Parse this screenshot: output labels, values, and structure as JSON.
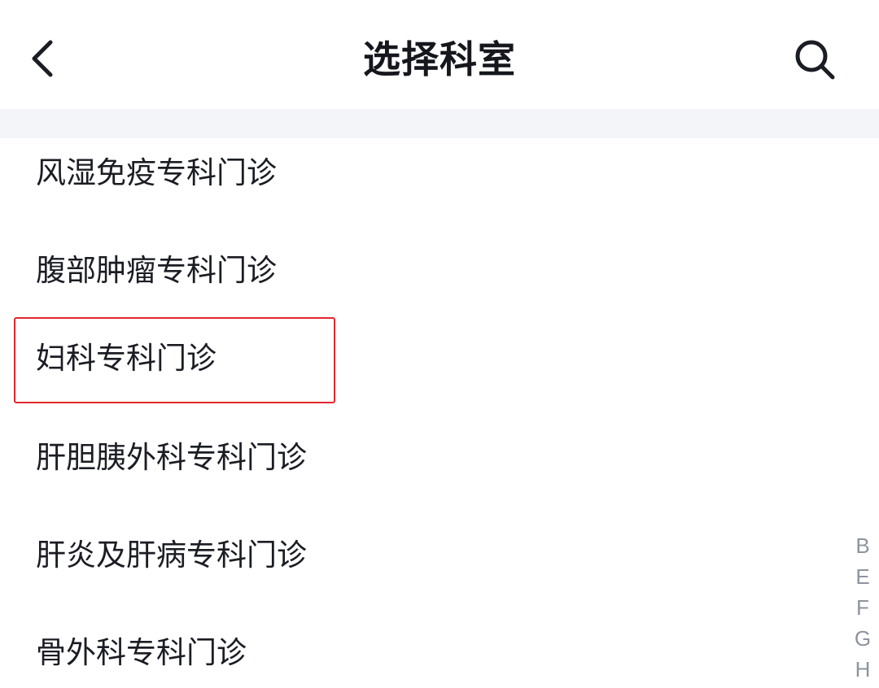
{
  "header": {
    "title": "选择科室",
    "back_icon": "chevron-left-icon",
    "search_icon": "search-icon"
  },
  "departments": [
    {
      "label": "风湿免疫专科门诊"
    },
    {
      "label": "腹部肿瘤专科门诊"
    },
    {
      "label": "妇科专科门诊",
      "highlighted": true
    },
    {
      "label": "肝胆胰外科专科门诊"
    },
    {
      "label": "肝炎及肝病专科门诊"
    },
    {
      "label": "骨外科专科门诊"
    }
  ],
  "index_letters": [
    "B",
    "E",
    "F",
    "G",
    "H"
  ],
  "colors": {
    "highlight_border": "#e0282e",
    "divider_band": "#f3f5f8",
    "index_letter": "#8e93a0",
    "text": "#1b1d24"
  }
}
